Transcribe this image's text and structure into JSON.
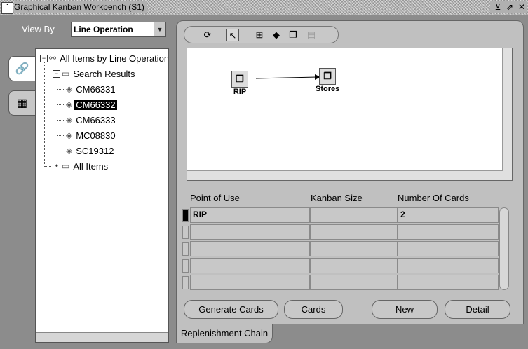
{
  "window": {
    "title": "Graphical Kanban Workbench (S1)",
    "controls": [
      "⊻",
      "⇗",
      "✕"
    ]
  },
  "view_by": {
    "label": "View By",
    "selected": "Line Operation"
  },
  "tree": {
    "root": "All Items by Line Operation",
    "search_results": "Search Results",
    "items": [
      "CM66331",
      "CM66332",
      "CM66333",
      "MC08830",
      "SC19312"
    ],
    "selected_item": "CM66332",
    "all_items": "All Items"
  },
  "diagram": {
    "nodes": [
      {
        "label": "RIP"
      },
      {
        "label": "Stores"
      }
    ]
  },
  "table": {
    "columns": [
      "Point of Use",
      "Kanban Size",
      "Number Of Cards"
    ],
    "rows": [
      [
        "RIP",
        "",
        "2"
      ],
      [
        "",
        "",
        ""
      ],
      [
        "",
        "",
        ""
      ],
      [
        "",
        "",
        ""
      ],
      [
        "",
        "",
        ""
      ]
    ]
  },
  "buttons": {
    "generate_cards": "Generate Cards",
    "cards": "Cards",
    "new": "New",
    "detail": "Detail"
  },
  "tab": {
    "label": "Replenishment Chain"
  }
}
